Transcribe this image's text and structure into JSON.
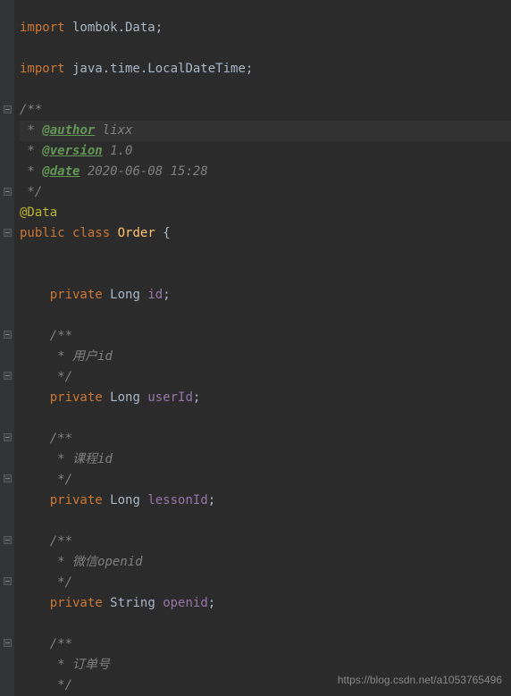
{
  "lines": {
    "l1_kw": "import",
    "l1_rest": " lombok.Data;",
    "l2_kw": "import",
    "l2_rest": " java.time.LocalDateTime;",
    "c_open": "/**",
    "c_author_tag": "@author",
    "c_author_val": " lixx",
    "c_version_tag": "@version",
    "c_version_val": " 1.0",
    "c_date_tag": "@date",
    "c_date_val": " 2020-06-08 15:28",
    "c_close": " */",
    "ann_data": "@Data",
    "cls_kw1": "public",
    "cls_kw2": "class",
    "cls_name": "Order",
    "brace_open": " {",
    "f1_kw": "private",
    "f1_type": "Long",
    "f1_name": "id",
    "semi": ";",
    "doc_user": "用户id",
    "f2_kw": "private",
    "f2_type": "Long",
    "f2_name": "userId",
    "doc_lesson": "课程id",
    "f3_kw": "private",
    "f3_type": "Long",
    "f3_name": "lessonId",
    "doc_openid": "微信openid",
    "f4_kw": "private",
    "f4_type": "String",
    "f4_name": "openid",
    "doc_orderno": "订单号",
    "star": " * ",
    "star_only": " *",
    "doc_open2": "/**",
    "doc_close2": " */"
  },
  "watermark": "https://blog.csdn.net/a1053765496"
}
